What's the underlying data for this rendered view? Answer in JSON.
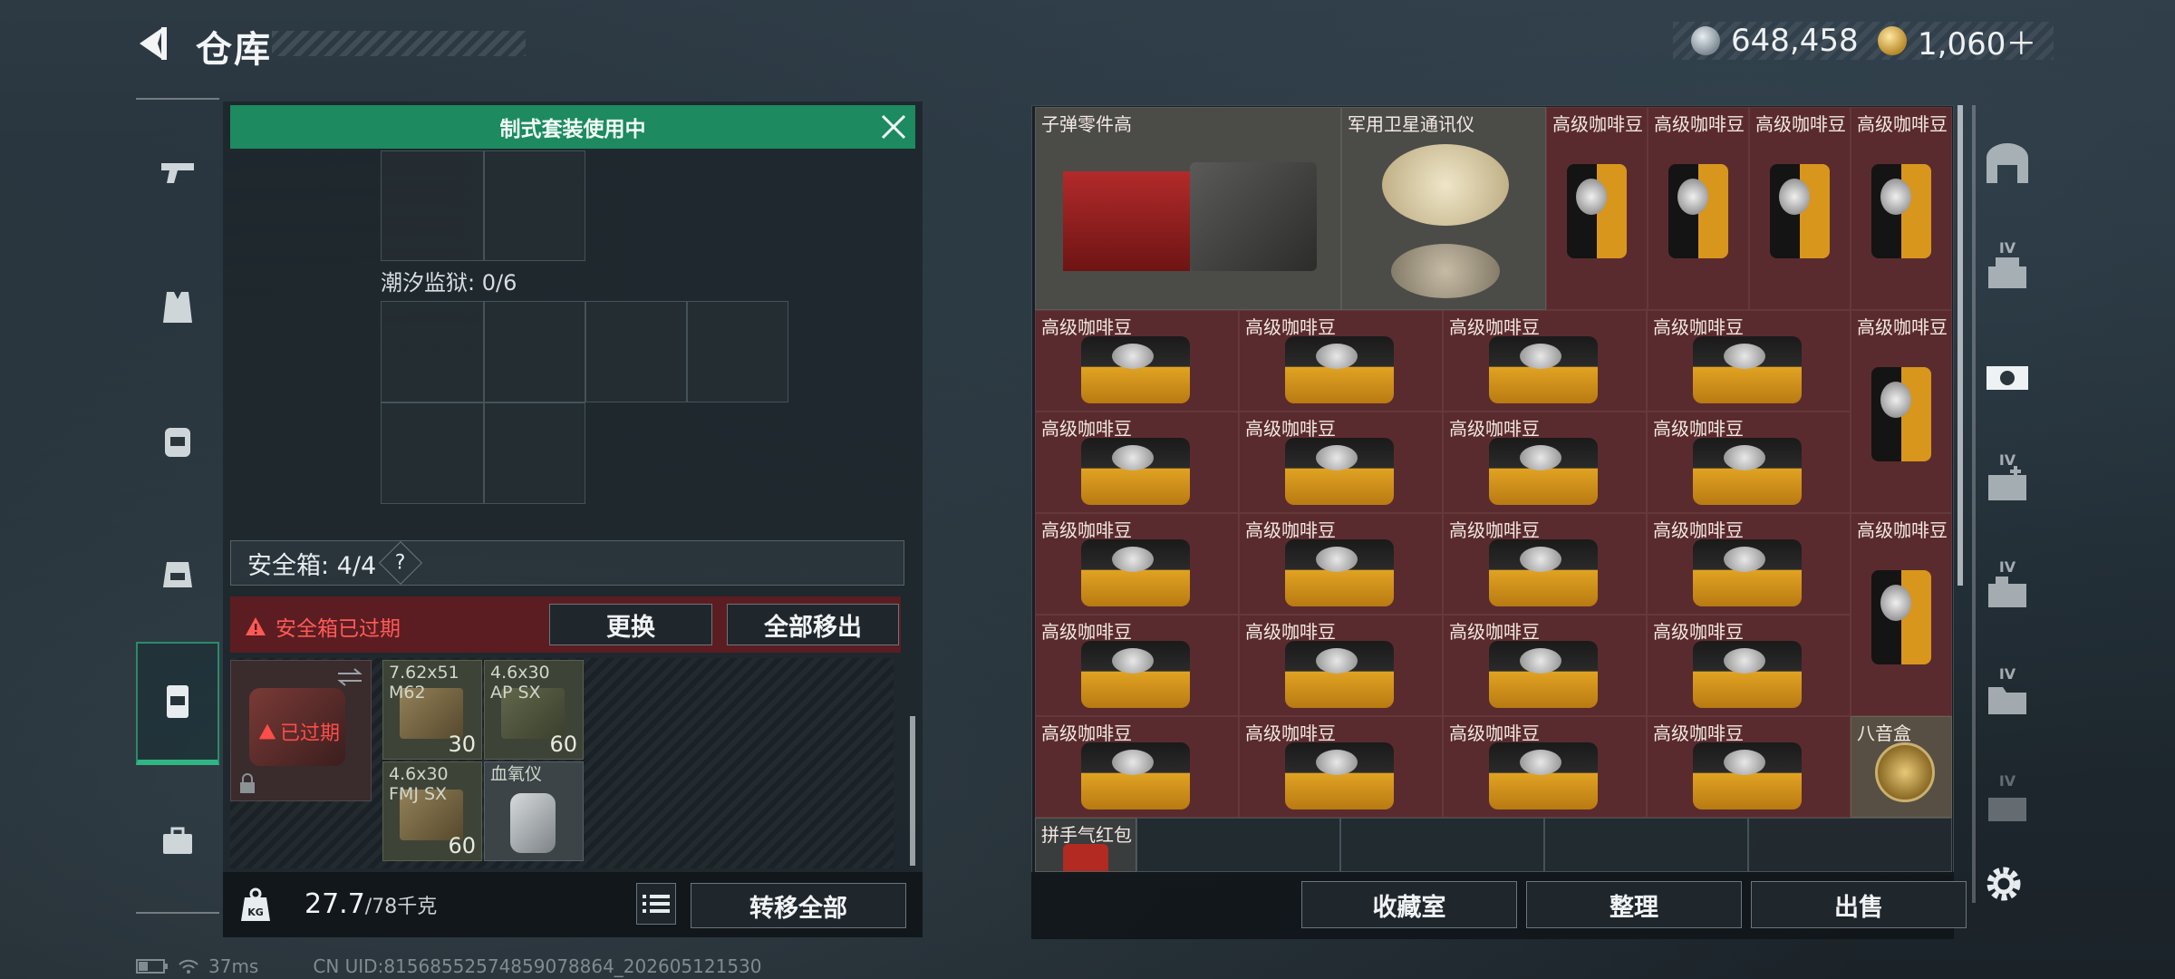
{
  "header": {
    "title": "仓库",
    "currency_silver": "648,458",
    "currency_gold": "1,060＋"
  },
  "left_panel": {
    "banner_text": "制式套装使用中",
    "sub_container_label": "潮汐监狱: 0/6",
    "safebox_label": "安全箱: 4/4",
    "safebox_help": "?",
    "expired_warning": "安全箱已过期",
    "replace_button": "更换",
    "move_all_out_button": "全部移出",
    "safebox_item_status": "已过期",
    "ammo_items": [
      {
        "name_line1": "7.62x51",
        "name_line2": "M62",
        "count": "30"
      },
      {
        "name_line1": "4.6x30",
        "name_line2": "AP SX",
        "count": "60"
      },
      {
        "name_line1": "4.6x30",
        "name_line2": "FMJ SX",
        "count": "60"
      },
      {
        "name_line1": "血氧仪",
        "name_line2": "",
        "count": ""
      }
    ],
    "weight_current": "27.7",
    "weight_max": "/78千克",
    "transfer_all_button": "转移全部"
  },
  "inventory": {
    "items": {
      "bullet_parts": "子弹零件高",
      "satellite": "军用卫星通讯仪",
      "coffee": "高级咖啡豆",
      "music_box": "八音盒",
      "red_packet": "拼手气红包"
    }
  },
  "bottom_right": {
    "collection_button": "收藏室",
    "organize_button": "整理",
    "sell_button": "出售"
  },
  "right_nav": {
    "tag": "IV"
  },
  "status_bar": {
    "ping": "37ms",
    "uid": "CN UID:8156855257485907886​4_202605121530"
  },
  "colors": {
    "accent_green": "#1d8a5f",
    "warning_red": "#ff5a57",
    "coffee_cell": "#5a2b2e"
  }
}
